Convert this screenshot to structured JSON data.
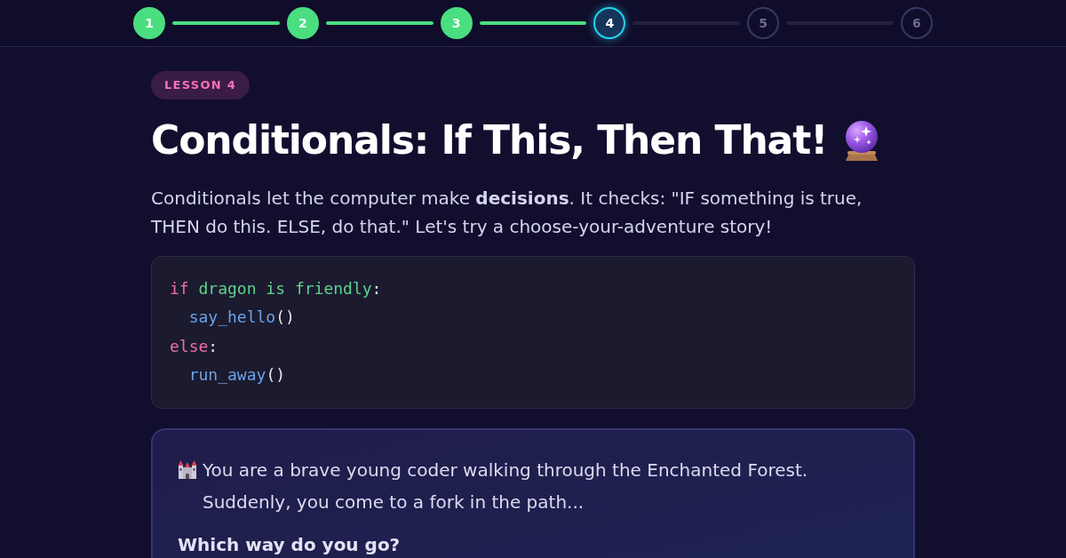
{
  "progress_steps": [
    {
      "label": "1",
      "completed": true,
      "selected": false
    },
    {
      "label": "2",
      "completed": true,
      "selected": false
    },
    {
      "label": "3",
      "completed": true,
      "selected": false
    },
    {
      "label": "4",
      "completed": false,
      "selected": true
    },
    {
      "label": "5",
      "completed": false,
      "selected": false
    },
    {
      "label": "6",
      "completed": false,
      "selected": false
    }
  ],
  "lesson": {
    "badge": "LESSON 4",
    "title": "Conditionals: If This, Then That!",
    "intro": "Conditionals let the computer make **decisions**. It checks: \"IF something is true, THEN do this. ELSE, do that.\" Let's try a choose-your-adventure story!"
  },
  "code_block": {
    "lines": [
      {
        "tokens": [
          {
            "kind": "keyword",
            "text": "if"
          },
          {
            "kind": "condition",
            "text": "dragon is friendly"
          },
          {
            "kind": "punctuation",
            "text": ":"
          }
        ],
        "children": [
          {
            "tokens": [
              {
                "kind": "function",
                "text": "say_hello"
              },
              {
                "kind": "punctuation",
                "text": "()"
              }
            ]
          }
        ]
      },
      {
        "tokens": [
          {
            "kind": "keyword",
            "text": "else"
          },
          {
            "kind": "punctuation",
            "text": ":"
          }
        ],
        "children": [
          {
            "tokens": [
              {
                "kind": "function",
                "text": "run_away"
              },
              {
                "kind": "punctuation",
                "text": "()"
              }
            ]
          }
        ]
      }
    ]
  },
  "story": {
    "text": "You are a brave young coder walking through the Enchanted Forest. Suddenly, you come to a fork in the path...",
    "question": "Which way do you go?"
  }
}
